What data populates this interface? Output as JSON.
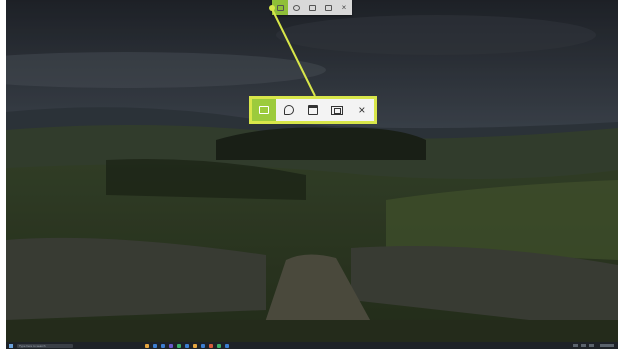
{
  "snip_toolbar": {
    "modes": [
      {
        "name": "rectangular-snip",
        "icon": "rectangle-snip-icon",
        "active": true
      },
      {
        "name": "freeform-snip",
        "icon": "freeform-snip-icon",
        "active": false
      },
      {
        "name": "window-snip",
        "icon": "window-snip-icon",
        "active": false
      },
      {
        "name": "fullscreen-snip",
        "icon": "fullscreen-snip-icon",
        "active": false
      }
    ],
    "close_label": "×"
  },
  "callout": {
    "highlight_color": "#d8e64a",
    "active_color": "#9ccb3c"
  },
  "taskbar": {
    "search_placeholder": "Type here to search",
    "background": "#1e2227",
    "app_colors": [
      "#e5a640",
      "#3d7fd1",
      "#3d7fd1",
      "#6a58c9",
      "#3cb06a",
      "#3d7fd1",
      "#e5a640",
      "#3d7fd1",
      "#d65b3a",
      "#3cb06a",
      "#3d7fd1"
    ]
  }
}
